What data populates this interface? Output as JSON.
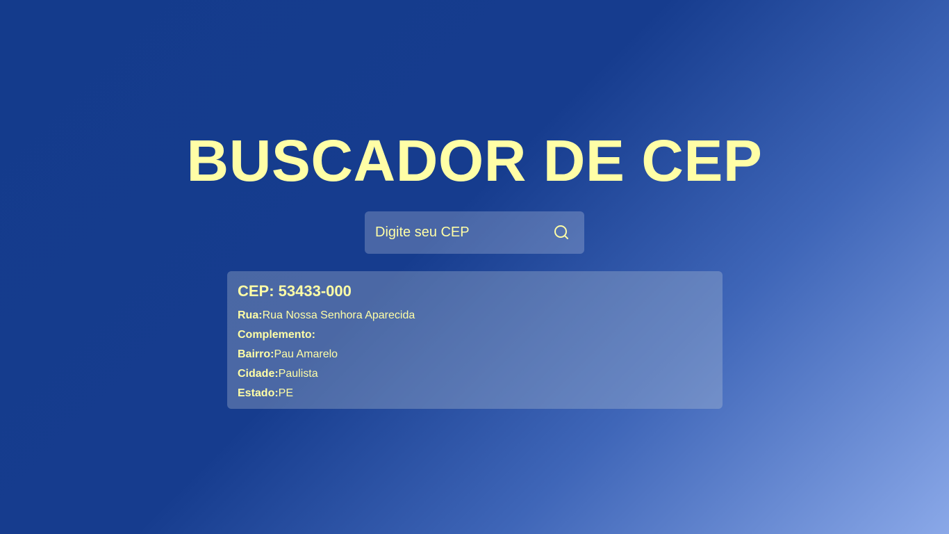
{
  "app": {
    "title": "BUSCADOR DE CEP"
  },
  "search": {
    "placeholder": "Digite seu CEP",
    "value": "",
    "button_icon": "search-icon"
  },
  "result": {
    "cep_heading": "CEP: 53433-000",
    "fields": [
      {
        "label": "Rua:",
        "value": "Rua Nossa Senhora Aparecida"
      },
      {
        "label": "Complemento:",
        "value": ""
      },
      {
        "label": "Bairro:",
        "value": "Pau Amarelo"
      },
      {
        "label": "Cidade:",
        "value": "Paulista"
      },
      {
        "label": "Estado:",
        "value": "PE"
      }
    ]
  },
  "colors": {
    "accent_text": "#fffea6",
    "background_dark": "#143b8c",
    "background_light": "#8aa8e8"
  }
}
